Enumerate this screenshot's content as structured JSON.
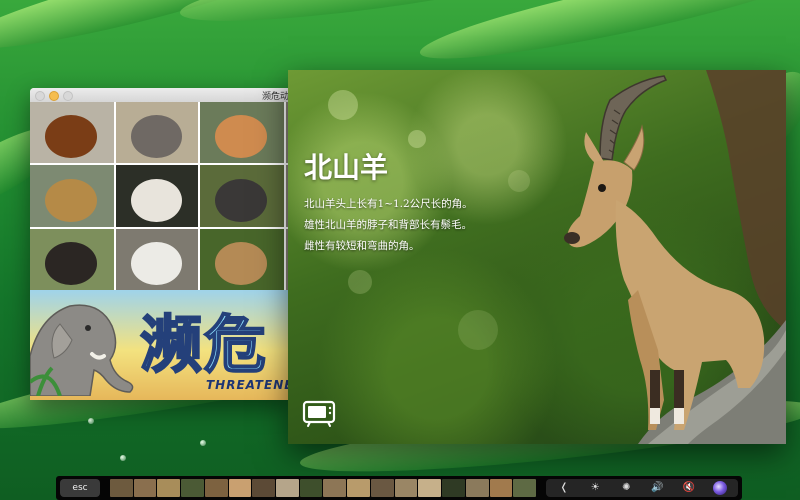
{
  "back_window": {
    "title": "濒危动",
    "traffic_lights": [
      "close",
      "minimize",
      "zoom"
    ],
    "tiles": [
      {
        "name": "orangutan",
        "color": "#7a3d16",
        "bg": "#b9b3a5"
      },
      {
        "name": "asian-elephant",
        "color": "#6f6964",
        "bg": "#b8ad95"
      },
      {
        "name": "proboscis-monkey",
        "color": "#cf8b4f",
        "bg": "#6b7b5a"
      },
      {
        "name": "jaguar",
        "color": "#b58a47",
        "bg": "#7d8a72"
      },
      {
        "name": "white-headed-monkey",
        "color": "#e8e4dc",
        "bg": "#2c2f27"
      },
      {
        "name": "tapir",
        "color": "#3a3837",
        "bg": "#5b6b3a"
      },
      {
        "name": "chimpanzee",
        "color": "#2b2623",
        "bg": "#7d8f5c"
      },
      {
        "name": "white-tiger",
        "color": "#ecebe6",
        "bg": "#7e7a70"
      },
      {
        "name": "ibex-thumb",
        "color": "#b48a55",
        "bg": "#48662a"
      }
    ],
    "banner": {
      "title": "濒危",
      "subtitle": "THREATENE"
    }
  },
  "detail_window": {
    "animal_name": "北山羊",
    "description_lines": [
      "北山羊头上长有1~1.2公尺长的角。",
      "雄性北山羊的脖子和背部长有鬃毛。",
      "雌性有较短和弯曲的角。"
    ],
    "tv_button_icon": "tv-icon"
  },
  "touch_bar": {
    "esc_label": "esc",
    "thumbnails": [
      "#6d5a3e",
      "#8a6f4e",
      "#a88d5a",
      "#4b5a35",
      "#7d6240",
      "#c9a070",
      "#5c4a36",
      "#b5a58a",
      "#3e4f2c",
      "#8d7656",
      "#b89b6b",
      "#6a5842",
      "#9a8665",
      "#c6b08a",
      "#2f3a24",
      "#8b7a5c",
      "#a17a4d",
      "#5e6a44"
    ],
    "controls": [
      {
        "icon": "chevron-left-icon",
        "label": "❬"
      },
      {
        "icon": "brightness-slider-icon",
        "label": "☀"
      },
      {
        "icon": "brightness-icon",
        "label": "✺"
      },
      {
        "icon": "volume-icon",
        "label": "🔊"
      },
      {
        "icon": "mute-icon",
        "label": "🔇"
      },
      {
        "icon": "siri-icon",
        "label": ""
      }
    ]
  }
}
